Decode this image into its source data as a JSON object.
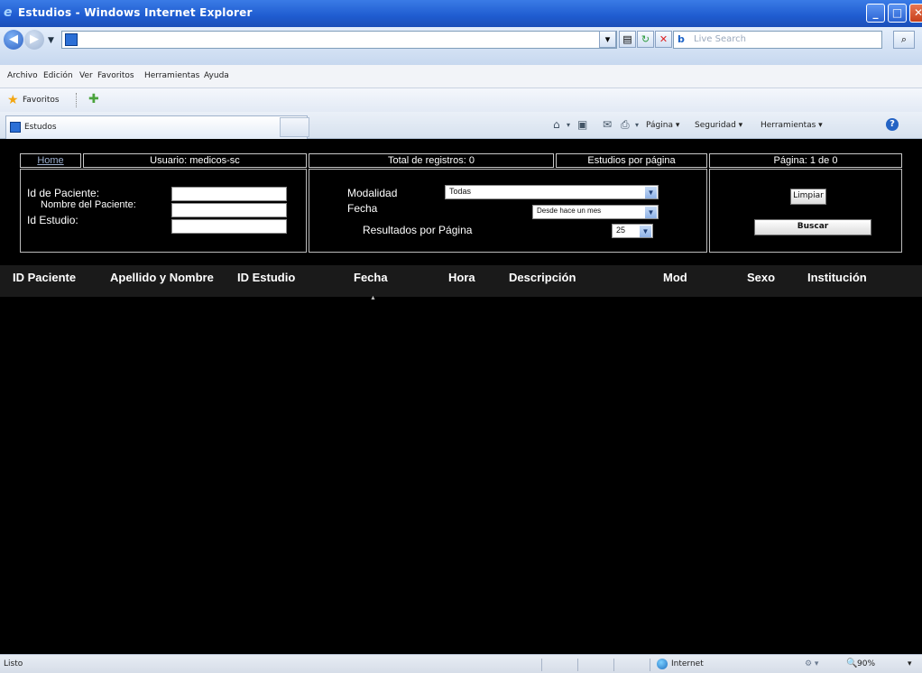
{
  "window": {
    "title": "Estudios - Windows Internet Explorer"
  },
  "address": {
    "search_placeholder": "Live Search"
  },
  "menu": [
    "Archivo",
    "Edición",
    "Ver",
    "Favoritos",
    "Herramientas",
    "Ayuda"
  ],
  "favorites": {
    "label": "Favoritos"
  },
  "tab": {
    "label": "Estudos"
  },
  "commandbar": {
    "page": "Página ▾",
    "security": "Seguridad ▾",
    "tools": "Herramientas ▾"
  },
  "header": {
    "home": "Home",
    "user": "Usuario: medicos-sc",
    "total": "Total de registros: 0",
    "per_page": "Estudios por página",
    "page_info": "Página: 1 de 0"
  },
  "form": {
    "patient_id_label": "Id de Paciente:",
    "patient_name_label": "Nombre del Paciente:",
    "study_id_label": "Id Estudio:",
    "modality_label": "Modalidad",
    "modality_value": "Todas",
    "date_label": "Fecha",
    "date_value": "Desde hace un mes",
    "results_label": "Resultados por Página",
    "results_value": "25",
    "clear_button": "Limpiar",
    "search_button": "Buscar"
  },
  "table": {
    "columns": [
      "ID Paciente",
      "Apellido y Nombre",
      "ID Estudio",
      "Fecha",
      "Hora",
      "Descripción",
      "Mod",
      "Sexo",
      "Institución"
    ],
    "rows": []
  },
  "status": {
    "text": "Listo",
    "zone": "Internet",
    "zoom": "90%"
  }
}
